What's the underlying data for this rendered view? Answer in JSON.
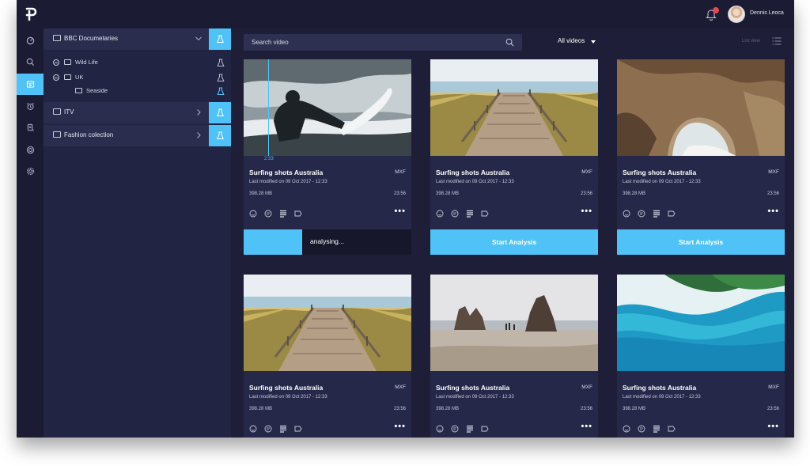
{
  "user": {
    "name": "Dennis Leoca",
    "notifications": "1"
  },
  "sidebar": {
    "icons": [
      "dashboard-icon",
      "search-icon",
      "media-library-icon",
      "alarm-icon",
      "device-icon",
      "target-icon",
      "settings-icon"
    ],
    "active_index": 2
  },
  "tree": {
    "groups": [
      {
        "label": "BBC Documetaries",
        "expanded": true
      },
      {
        "label": "ITV",
        "expanded": false
      },
      {
        "label": "Fashion colection",
        "expanded": false
      }
    ],
    "children": [
      {
        "label": "Wild Life"
      },
      {
        "label": "UK"
      },
      {
        "label": "Seaside",
        "active": true
      }
    ]
  },
  "toolbar": {
    "search_placeholder": "Search video",
    "filter_label": "All videos",
    "list_view_label": "List view"
  },
  "cards": [
    {
      "title": "Surfing shots Australia",
      "format": "MXF",
      "modified": "Last modified on 09 Oct 2017 - 12:33",
      "size": "398.28 MB",
      "duration": "23:56",
      "scrub_time": "2:33",
      "status": "analysing",
      "progress_label": "analysing...",
      "progress": 0.35,
      "image": "surfer"
    },
    {
      "title": "Surfing shots Australia",
      "format": "MXF",
      "modified": "Last modified on 09 Oct 2017 - 12:33",
      "size": "398.28 MB",
      "duration": "23:56",
      "status": "idle",
      "action_label": "Start Analysis",
      "image": "boardwalk"
    },
    {
      "title": "Surfing shots Australia",
      "format": "MXF",
      "modified": "Last modified on 09 Oct 2017 - 12:33",
      "size": "398.28 MB",
      "duration": "23:56",
      "status": "idle",
      "action_label": "Start Analysis",
      "image": "cave"
    },
    {
      "title": "Surfing shots Australia",
      "format": "MXF",
      "modified": "Last modified on 09 Oct 2017 - 12:33",
      "size": "398.28 MB",
      "duration": "23:56",
      "image": "boardwalk"
    },
    {
      "title": "Surfing shots Australia",
      "format": "MXF",
      "modified": "Last modified on 09 Oct 2017 - 12:33",
      "size": "398.28 MB",
      "duration": "23:56",
      "image": "rocks"
    },
    {
      "title": "Surfing shots Australia",
      "format": "MXF",
      "modified": "Last modified on 09 Oct 2017 - 12:33",
      "size": "398.28 MB",
      "duration": "23:56",
      "image": "aerial"
    }
  ],
  "card_icons": [
    "face-icon",
    "speech-icon",
    "text-lines-icon",
    "tag-icon"
  ],
  "colors": {
    "accent": "#4fc3f7",
    "background": "#1e1e38",
    "panel": "#222443",
    "card": "#26284a"
  }
}
